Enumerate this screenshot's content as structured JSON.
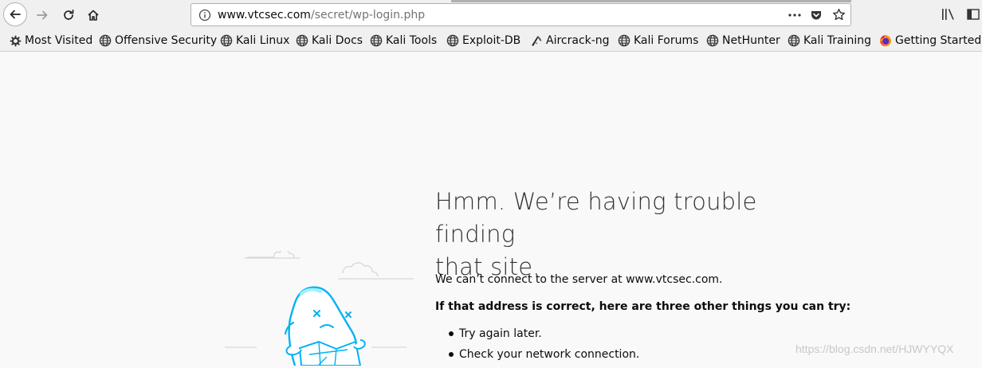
{
  "browser": {
    "url_host": "www.vtcsec.com",
    "url_path": "/secret/wp-login.php",
    "icons": [
      "back-icon",
      "forward-icon",
      "reload-icon",
      "home-icon",
      "info-icon",
      "page-actions-icon",
      "pocket-icon",
      "bookmark-star-icon",
      "library-icon",
      "sidebar-icon"
    ]
  },
  "bookmarks": [
    {
      "label": "Most Visited",
      "icon": "gear-icon"
    },
    {
      "label": "Offensive Security",
      "icon": "globe-icon"
    },
    {
      "label": "Kali Linux",
      "icon": "globe-icon"
    },
    {
      "label": "Kali Docs",
      "icon": "globe-icon"
    },
    {
      "label": "Kali Tools",
      "icon": "globe-icon"
    },
    {
      "label": "Exploit-DB",
      "icon": "globe-icon"
    },
    {
      "label": "Aircrack-ng",
      "icon": "aircrack-icon"
    },
    {
      "label": "Kali Forums",
      "icon": "globe-icon"
    },
    {
      "label": "NetHunter",
      "icon": "globe-icon"
    },
    {
      "label": "Kali Training",
      "icon": "globe-icon"
    },
    {
      "label": "Getting Started",
      "icon": "firefox-icon"
    }
  ],
  "error": {
    "title_line1": "Hmm. We’re having trouble finding",
    "title_line2": "that site.",
    "description": "We can’t connect to the server at www.vtcsec.com.",
    "suggestions_title": "If that address is correct, here are three other things you can try:",
    "suggestions": [
      "Try again later.",
      "Check your network connection."
    ]
  },
  "watermark": "https://blog.csdn.net/HJWYYQX",
  "colors": {
    "accent": "#0a84ff",
    "illustration": "#00b3f4",
    "toolbar": "#f0f0f0"
  }
}
